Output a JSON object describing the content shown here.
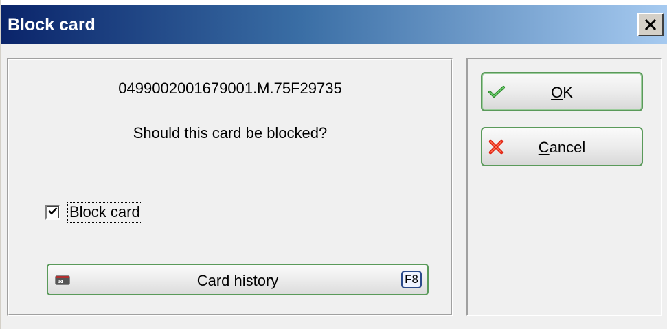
{
  "window": {
    "title": "Block card",
    "close_symbol": "×"
  },
  "card": {
    "id": "0499002001679001.M.75F29735",
    "question": "Should this card be blocked?"
  },
  "block_checkbox": {
    "label": "Block card",
    "checked": true
  },
  "history_button": {
    "label": "Card history",
    "shortcut": "F8",
    "icon": "id-card-icon"
  },
  "ok_button": {
    "mnemonic": "O",
    "rest": "K",
    "icon": "checkmark-icon"
  },
  "cancel_button": {
    "mnemonic": "C",
    "rest": "ancel",
    "icon": "red-x-icon"
  },
  "colors": {
    "title_start": "#0a246a",
    "title_end": "#a6caf0",
    "button_border": "#5a9a5a",
    "ok_check": "#2e8b2e",
    "cancel_x": "#e02010"
  }
}
